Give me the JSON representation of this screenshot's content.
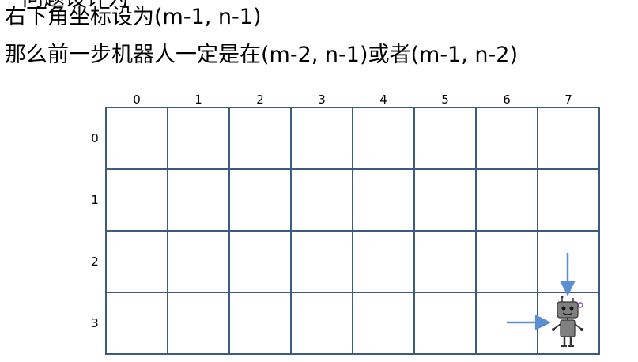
{
  "slide": {
    "top_clipped_text": "问题设计为",
    "line1": "右下角坐标设为(m-1, n-1)",
    "line2": "那么前一步机器人一定是在(m-2, n-1)或者(m-1, n-2)"
  },
  "grid": {
    "columns": [
      "0",
      "1",
      "2",
      "3",
      "4",
      "5",
      "6",
      "7"
    ],
    "rows": [
      "0",
      "1",
      "2",
      "3"
    ],
    "line_color": "#3d5a80",
    "arrow_color": "#5b8fd1",
    "robot_cell": {
      "row": 3,
      "col": 7
    }
  }
}
